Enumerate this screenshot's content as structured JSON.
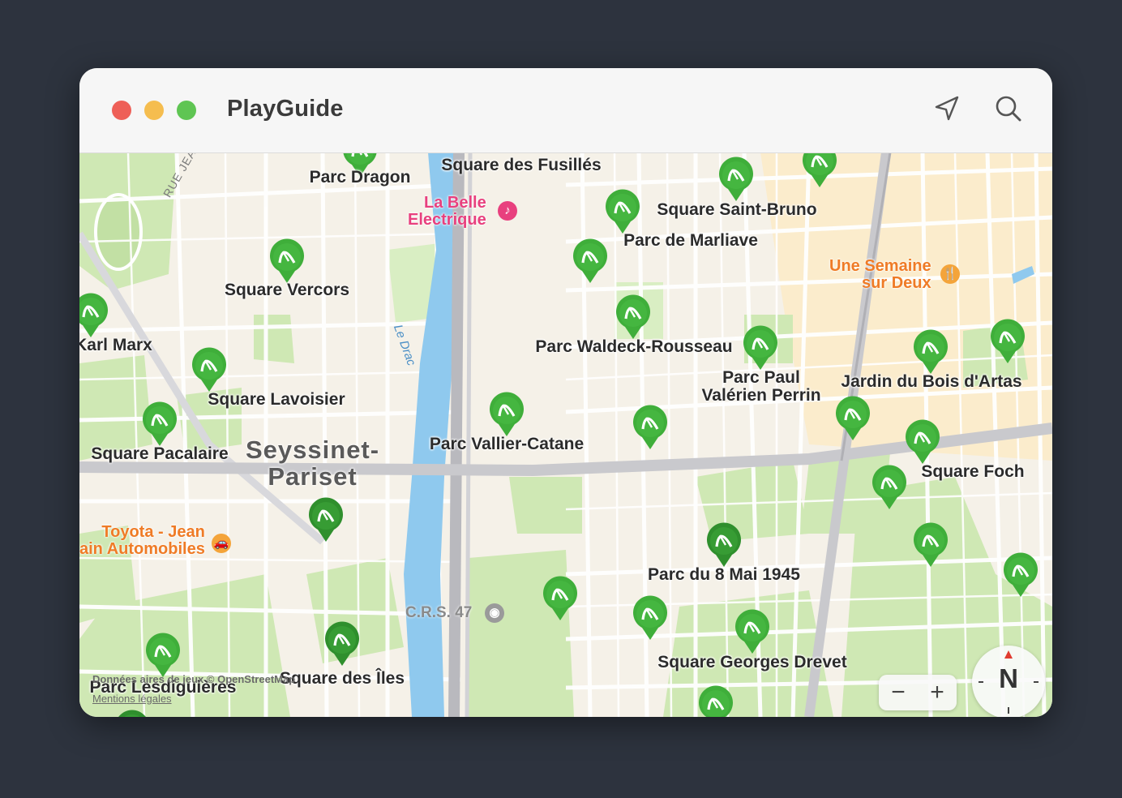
{
  "window": {
    "title": "PlayGuide"
  },
  "toolbar": {
    "location_icon": "location-arrow-icon",
    "search_icon": "search-icon"
  },
  "colors": {
    "pin": "#3fae3a",
    "park": "#cde9b0",
    "road": "#ffffff",
    "river": "#8fc9ee",
    "background": "#2d333e"
  },
  "map": {
    "parks": [
      {
        "name": "Parc Dragon"
      },
      {
        "name": "Square des Fusillés"
      },
      {
        "name": "Square Saint-Bruno"
      },
      {
        "name": "Parc de Marliave"
      },
      {
        "name": "Square Vercors"
      },
      {
        "name": "Karl Marx"
      },
      {
        "name": "Parc Waldeck-Rousseau"
      },
      {
        "name": "Parc Paul\nValérien Perrin"
      },
      {
        "name": "Jardin du Bois d'Artas"
      },
      {
        "name": "Square Lavoisier"
      },
      {
        "name": "Square Pacalaire"
      },
      {
        "name": "Parc Vallier-Catane"
      },
      {
        "name": "Square Foch"
      },
      {
        "name": "Parc du 8 Mai 1945"
      },
      {
        "name": "Square Georges Drevet"
      },
      {
        "name": "Square des Îles"
      },
      {
        "name": "Parc Lesdiguières"
      }
    ],
    "pois": {
      "music": "La Belle\nElectrique",
      "food": "Une Semaine\nsur Deux",
      "car": "Toyota - Jean\nain Automobiles"
    },
    "district": "Seyssinet-\nPariset",
    "street": "RUE JEAN BOCQ",
    "river": "Le Drac",
    "crs": "C.R.S. 47",
    "attribution": "Données aires de jeux © OpenStreetMap",
    "legal": "Mentions légales"
  },
  "controls": {
    "zoom_out": "−",
    "zoom_in": "+",
    "compass": "N"
  }
}
